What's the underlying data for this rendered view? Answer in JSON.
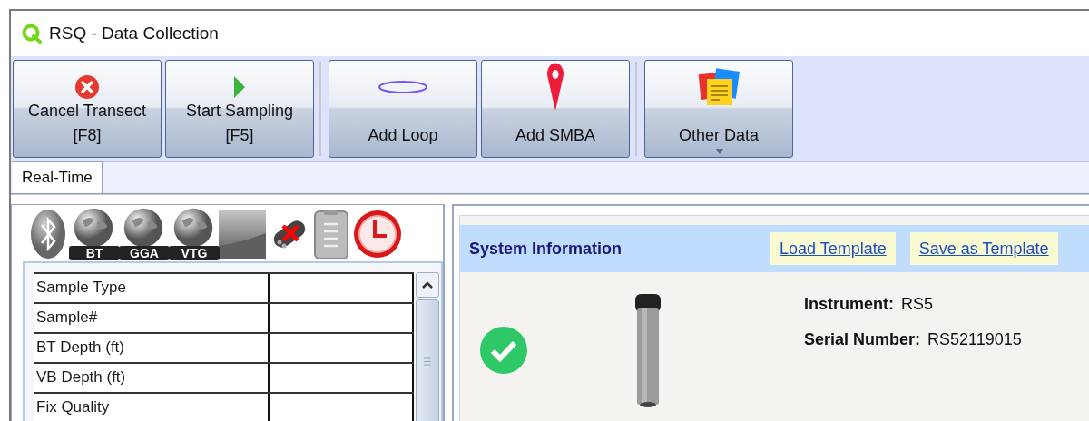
{
  "window": {
    "title": "RSQ - Data Collection"
  },
  "toolbar": {
    "groups": [
      {
        "buttons": [
          {
            "label": "Cancel Transect",
            "shortcut": "[F8]",
            "kind": "cancel"
          },
          {
            "label": "Start Sampling",
            "shortcut": "[F5]",
            "kind": "play"
          }
        ]
      },
      {
        "buttons": [
          {
            "label": "Add Loop",
            "kind": "loop"
          },
          {
            "label": "Add SMBA",
            "kind": "pin"
          }
        ]
      },
      {
        "buttons": [
          {
            "label": "Other Data",
            "kind": "notes",
            "dropdown": true
          }
        ]
      }
    ]
  },
  "tabs": [
    {
      "label": "Real-Time",
      "selected": true
    }
  ],
  "status_icons": [
    {
      "kind": "bluetooth"
    },
    {
      "kind": "globe",
      "label": "BT"
    },
    {
      "kind": "globe",
      "label": "GGA"
    },
    {
      "kind": "globe",
      "label": "VTG"
    },
    {
      "kind": "signal"
    },
    {
      "kind": "instrument_error"
    },
    {
      "kind": "clipboard"
    },
    {
      "kind": "clock"
    }
  ],
  "readings": [
    {
      "label": "Sample Type"
    },
    {
      "label": "Sample#"
    },
    {
      "label": "BT Depth (ft)"
    },
    {
      "label": "VB Depth (ft)"
    },
    {
      "label": "Fix Quality"
    }
  ],
  "system_information": {
    "title": "System Information",
    "links": [
      "Load Template",
      "Save as Template"
    ],
    "fields": [
      {
        "label": "Instrument:",
        "value": "RS5"
      },
      {
        "label": "Serial Number:",
        "value": "RS52119015"
      }
    ]
  }
}
